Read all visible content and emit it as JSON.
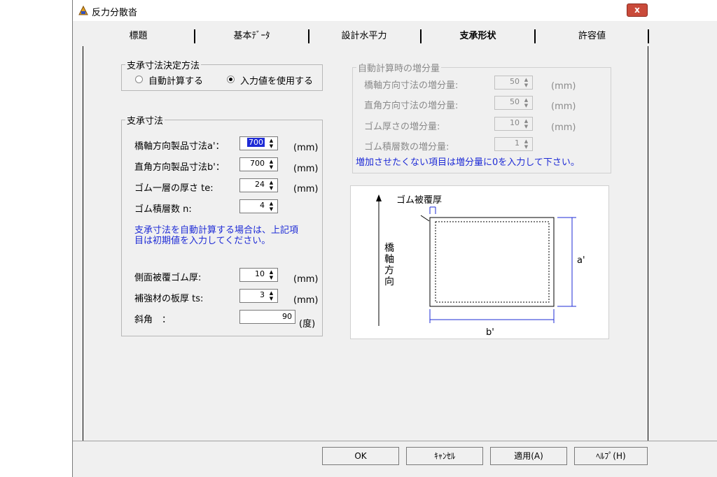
{
  "window": {
    "title": "反力分散沓",
    "close_label": "x"
  },
  "tabs": [
    {
      "label": "標題"
    },
    {
      "label": "基本ﾃﾞｰﾀ"
    },
    {
      "label": "設計水平力"
    },
    {
      "label": "支承形状"
    },
    {
      "label": "許容値"
    }
  ],
  "method_group": {
    "title": "支承寸法決定方法",
    "option_auto": "自動計算する",
    "option_input": "入力値を使用する",
    "selected": "入力値を使用する"
  },
  "dims_group": {
    "title": "支承寸法",
    "a_label": "橋軸方向製品寸法a'：",
    "a_value": "700",
    "b_label": "直角方向製品寸法b'：",
    "b_value": "700",
    "te_label": "ゴム一層の厚さ te:",
    "te_value": "24",
    "n_label": "ゴム積層数 n:",
    "n_value": "4",
    "note": "支承寸法を自動計算する場合は、上記項目は初期値を入力してください。",
    "cover_label": "側面被覆ゴム厚:",
    "cover_value": "10",
    "ts_label": "補強材の板厚 ts:",
    "ts_value": "3",
    "skew_label": "斜角　：",
    "skew_value": "90",
    "unit_mm": "(mm)",
    "unit_deg": "(度)"
  },
  "increment_group": {
    "title": "自動計算時の増分量",
    "axial_label": "橋軸方向寸法の増分量:",
    "axial_value": "50",
    "perp_label": "直角方向寸法の増分量:",
    "perp_value": "50",
    "rubber_label": "ゴム厚さの増分量:",
    "rubber_value": "10",
    "layers_label": "ゴム積層数の増分量:",
    "layers_value": "1",
    "unit_mm": "(mm)",
    "note": "増加させたくない項目は増分量に0を入力して下さい。"
  },
  "diagram": {
    "cover_label": "ゴム被覆厚",
    "direction_label": "橋軸方向",
    "a_label": "a'",
    "b_label": "b'"
  },
  "buttons": {
    "ok": "OK",
    "cancel": "ｷｬﾝｾﾙ",
    "apply": "適用(A)",
    "help": "ﾍﾙﾌﾟ(H)"
  },
  "colors": {
    "accent_blue": "#1e2bd6",
    "close_red": "#c94a3a"
  }
}
